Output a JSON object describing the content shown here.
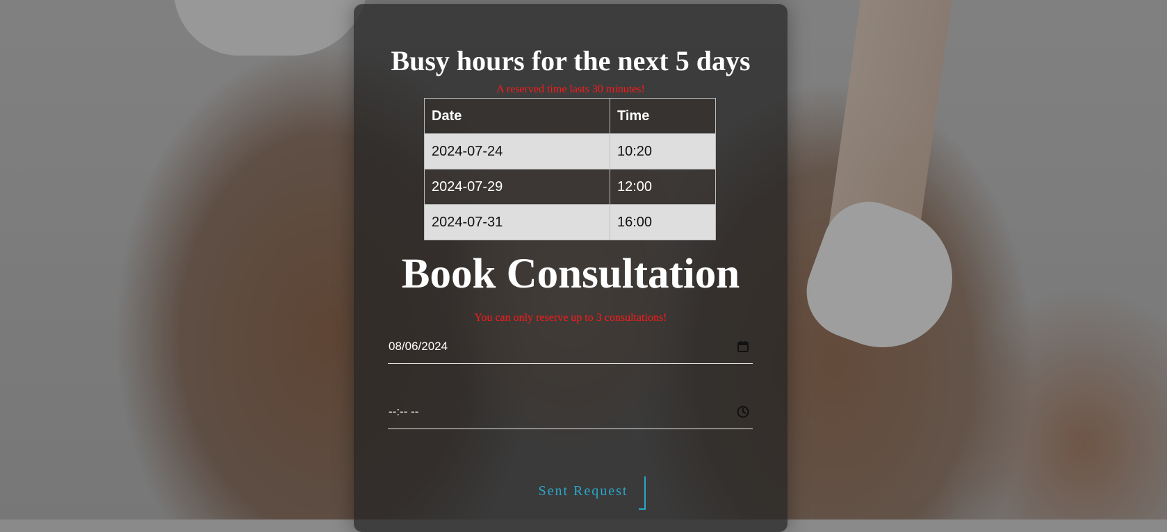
{
  "busy": {
    "title": "Busy hours for the next 5 days",
    "note": "A reserved time lasts 30 minutes!",
    "columns": [
      "Date",
      "Time"
    ],
    "rows": [
      {
        "date": "2024-07-24",
        "time": "10:20"
      },
      {
        "date": "2024-07-29",
        "time": "12:00"
      },
      {
        "date": "2024-07-31",
        "time": "16:00"
      }
    ]
  },
  "booking": {
    "title": "Book Consultation",
    "note": "You can only reserve up to 3 consultations!",
    "date_value": "08/06/2024",
    "time_value": "--:-- --",
    "submit_label": "Sent Request"
  },
  "icons": {
    "date": "calendar-icon",
    "time": "clock-icon"
  },
  "colors": {
    "warning": "#ff1a1a",
    "accent": "#2aa6c9"
  }
}
